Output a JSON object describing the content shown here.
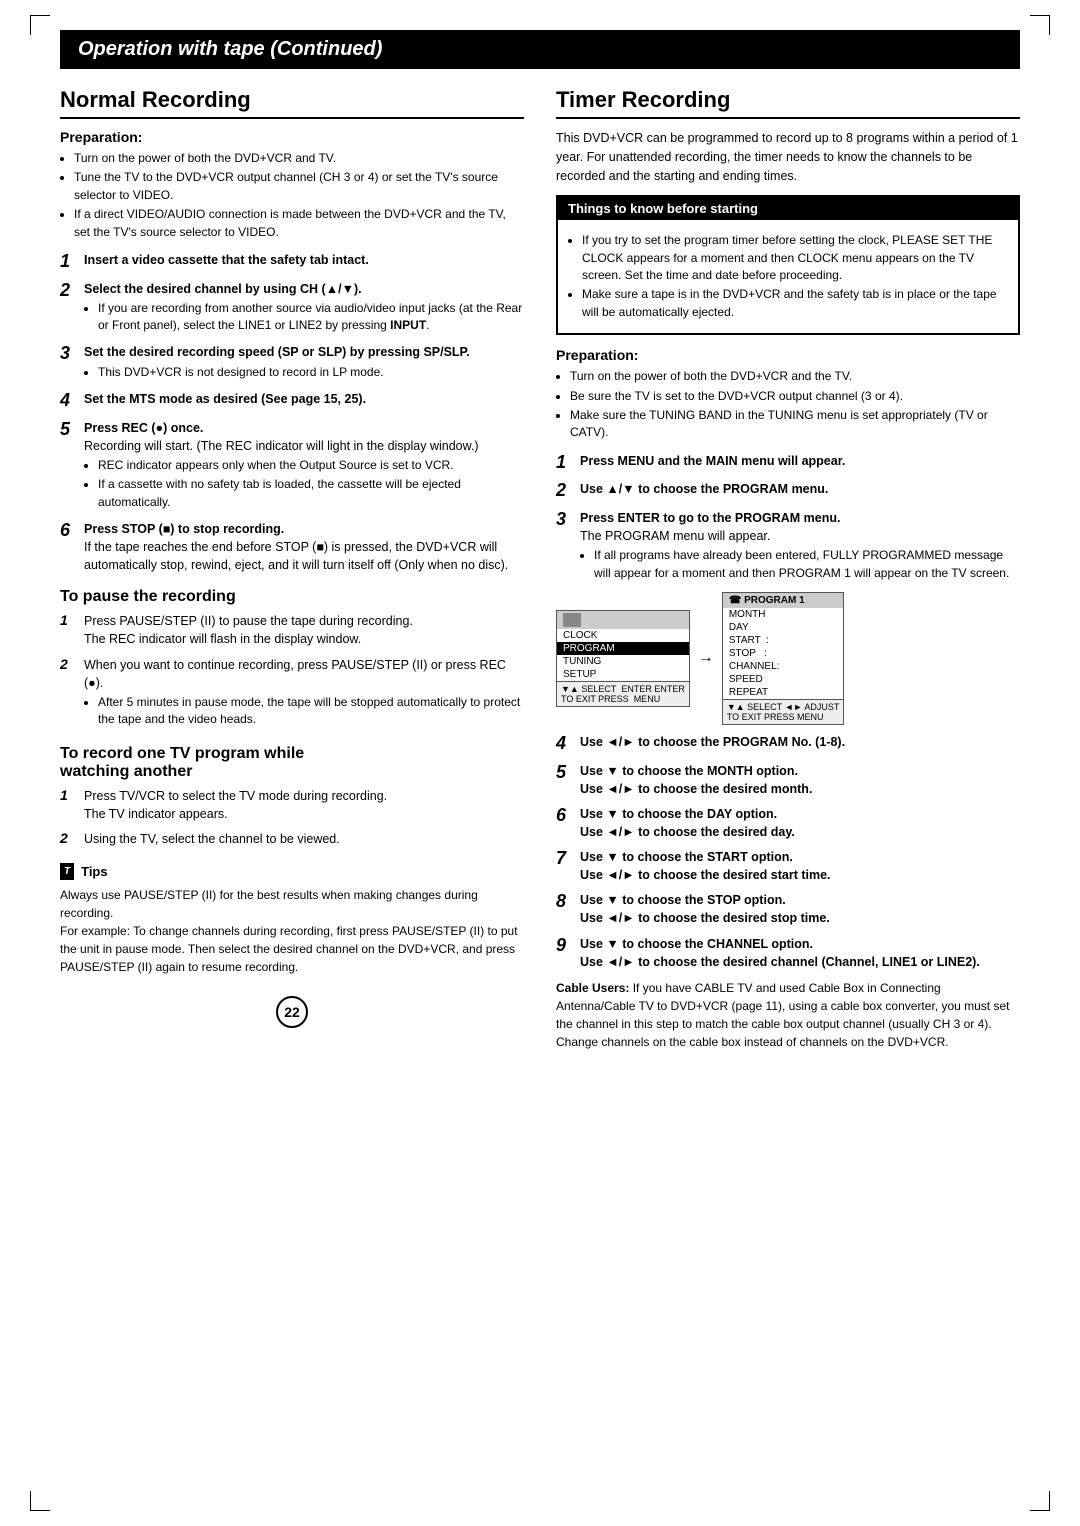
{
  "page": {
    "header": "Operation with tape (Continued)",
    "page_number": "22",
    "left": {
      "title": "Normal Recording",
      "preparation_label": "Preparation:",
      "preparation_bullets": [
        "Turn on the power of both the DVD+VCR and TV.",
        "Tune the TV to the DVD+VCR output channel (CH 3 or 4) or set the TV's source selector to VIDEO.",
        "If a direct VIDEO/AUDIO connection is made between the DVD+VCR and the TV, set the TV's source selector to VIDEO."
      ],
      "steps": [
        {
          "number": "1",
          "text": "Insert a video cassette that the safety tab intact."
        },
        {
          "number": "2",
          "text": "Select the desired channel by using CH (▲/▼).",
          "sub_bullets": [
            "If you are recording from another source via audio/video input jacks (at the Rear or Front panel), select the LINE1 or LINE2 by pressing INPUT."
          ]
        },
        {
          "number": "3",
          "text": "Set the desired recording speed (SP or SLP) by pressing SP/SLP.",
          "sub_bullets": [
            "This DVD+VCR is not designed to record in LP mode."
          ]
        },
        {
          "number": "4",
          "text": "Set the MTS mode as desired (See page 15, 25)."
        },
        {
          "number": "5",
          "text": "Press REC (●) once.",
          "extra": "Recording will start. (The REC indicator will light in the display window.)",
          "sub_bullets": [
            "REC indicator appears only when the Output Source is set to VCR.",
            "If a cassette with no safety tab is loaded, the cassette will be ejected automatically."
          ]
        },
        {
          "number": "6",
          "text": "Press STOP (■) to stop recording.",
          "extra": "If the tape reaches the end before STOP (■) is pressed, the DVD+VCR will automatically stop, rewind, eject, and it will turn itself off (Only when no disc)."
        }
      ],
      "pause_title": "To pause the recording",
      "pause_items": [
        {
          "num": "1",
          "text": "Press PAUSE/STEP (II) to pause the tape during recording.",
          "extra": "The REC indicator will flash in the display window."
        },
        {
          "num": "2",
          "text": "When you want to continue recording, press PAUSE/STEP (II) or press REC (●).",
          "sub_bullets": [
            "After 5 minutes in pause mode, the tape will be stopped automatically to protect the tape and the video heads."
          ]
        }
      ],
      "watch_title": "To record one TV program while watching another",
      "watch_items": [
        {
          "num": "1",
          "text": "Press TV/VCR to select the TV mode during recording.",
          "extra": "The TV indicator appears."
        },
        {
          "num": "2",
          "text": "Using the TV, select the channel to be viewed."
        }
      ],
      "tips_title": "Tips",
      "tips_text": "Always use PAUSE/STEP (II) for the best results when making changes during recording.\nFor example: To change channels during recording, first press PAUSE/STEP (II) to put the unit in pause mode. Then select the desired channel on the DVD+VCR, and press PAUSE/STEP (II) again to resume recording."
    },
    "right": {
      "title": "Timer Recording",
      "intro": "This DVD+VCR can be programmed to record up to 8 programs within a period of 1 year. For unattended recording, the timer needs to know the channels to be recorded and the starting and ending times.",
      "things_title": "Things to know before starting",
      "things_bullets": [
        "If you try to set the program timer before setting the clock, PLEASE SET THE CLOCK appears for a moment and then CLOCK menu appears on the TV screen. Set the time and date before proceeding.",
        "Make sure a tape is in the DVD+VCR and the safety tab is in place or the tape will be automatically ejected."
      ],
      "preparation_label": "Preparation:",
      "preparation_bullets": [
        "Turn on the power of both the DVD+VCR and the TV.",
        "Be sure the TV is set to the DVD+VCR output channel (3 or 4).",
        "Make sure the TUNING BAND in the TUNING menu is set appropriately (TV or CATV)."
      ],
      "steps": [
        {
          "number": "1",
          "text": "Press MENU and the MAIN menu will appear."
        },
        {
          "number": "2",
          "text": "Use ▲/▼ to choose the PROGRAM menu."
        },
        {
          "number": "3",
          "text": "Press ENTER to go to the PROGRAM menu.",
          "extra": "The PROGRAM menu will appear.",
          "sub_bullets": [
            "If all programs have already been entered, FULLY PROGRAMMED message will appear for a moment and then PROGRAM 1 will appear on the TV screen."
          ]
        },
        {
          "number": "4",
          "text": "Use ◄/► to choose the PROGRAM No. (1-8)."
        },
        {
          "number": "5",
          "text": "Use ▼ to choose the MONTH option.",
          "extra": "Use ◄/► to choose the desired month."
        },
        {
          "number": "6",
          "text": "Use ▼ to choose the DAY option.",
          "extra": "Use ◄/► to choose the desired day."
        },
        {
          "number": "7",
          "text": "Use ▼ to choose the START option.",
          "extra": "Use ◄/► to choose the desired start time."
        },
        {
          "number": "8",
          "text": "Use ▼ to choose the STOP option.",
          "extra": "Use ◄/► to choose the desired stop time."
        },
        {
          "number": "9",
          "text": "Use ▼ to choose the CHANNEL option.",
          "extra": "Use ◄/► to choose the desired channel (Channel, LINE1 or LINE2)."
        }
      ],
      "diagram": {
        "main_menu_items": [
          "CLOCK",
          "PROGRAM",
          "TUNING",
          "SETUP"
        ],
        "main_menu_selected": "PROGRAM",
        "main_footer": "▼▲ SELECT ENTER ENTER  TO EXIT PRESS MENU",
        "program_header": "PROGRAM 1",
        "program_items": [
          "MONTH",
          "DAY",
          "START :",
          "STOP :",
          "CHANNEL:",
          "SPEED",
          "REPEAT"
        ],
        "program_footer": "▼▲ SELECT ◄► ADJUST  TO EXIT PRESS MENU"
      },
      "cable_label": "Cable Users:",
      "cable_text": "If you have CABLE TV and used Cable Box in Connecting Antenna/Cable TV to DVD+VCR (page 11), using a cable box converter, you must set the channel in this step to match the cable box output channel (usually CH 3 or 4). Change channels on the cable box instead of channels on the DVD+VCR."
    }
  }
}
